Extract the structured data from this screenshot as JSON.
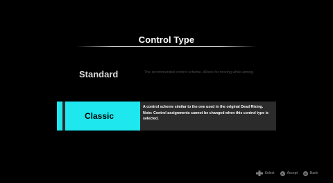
{
  "screen": {
    "title": "Control Type"
  },
  "options": {
    "standard": {
      "label": "Standard",
      "description": "The recommended control scheme. Allows for moving while aiming."
    },
    "classic": {
      "label": "Classic",
      "description_line1": "A control scheme similar to the one used in the original Dead Rising.",
      "description_line2": "Note: Control assignments cannot be changed when this control type is selected.",
      "selected": true
    }
  },
  "footer": {
    "select_label": "Select",
    "accept_button_glyph": "A",
    "accept_label": "Accept",
    "back_button_glyph": "B",
    "back_label": "Back"
  },
  "colors": {
    "background": "#000000",
    "accent": "#1fe7ee",
    "selected_row_bg": "#2b2b2b",
    "inactive_text": "#4a4a4a"
  },
  "icons": {
    "select": "dpad-icon",
    "accept": "a-button-icon",
    "back": "b-button-icon"
  }
}
